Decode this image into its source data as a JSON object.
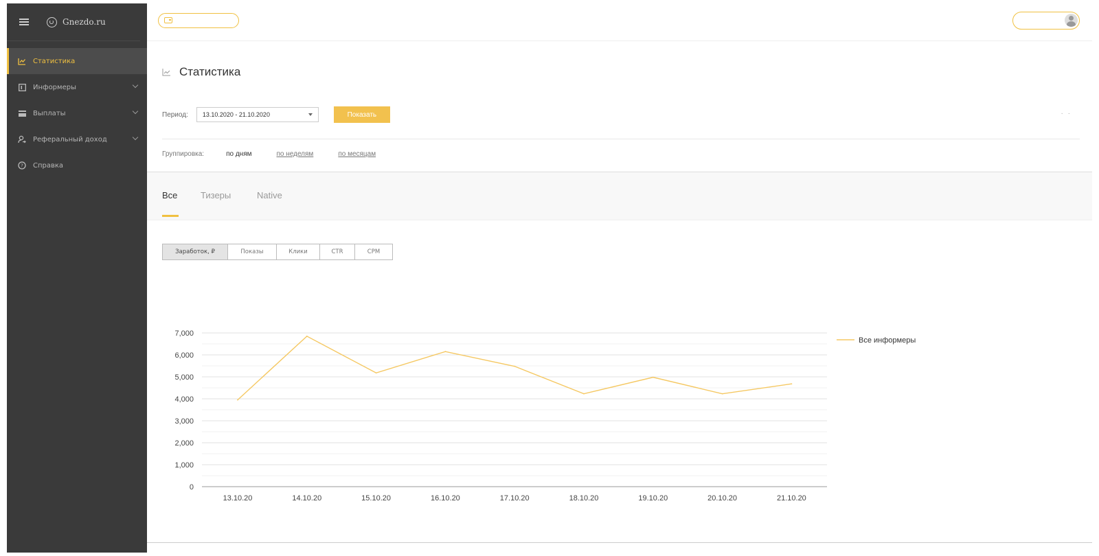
{
  "sidebar": {
    "logo_text": "Gnezdo.ru",
    "items": [
      {
        "label": "Статистика",
        "icon": "chart-icon",
        "active": true
      },
      {
        "label": "Информеры",
        "icon": "informer-icon",
        "has_children": true
      },
      {
        "label": "Выплаты",
        "icon": "card-icon",
        "has_children": true
      },
      {
        "label": "Реферальный доход",
        "icon": "referral-icon",
        "has_children": true
      },
      {
        "label": "Справка",
        "icon": "help-icon"
      }
    ]
  },
  "page": {
    "title": "Статистика",
    "period_label": "Период:",
    "period_value": "13.10.2020 - 21.10.2020",
    "show_button": "Показать",
    "dots": "· ·",
    "grouping_label": "Группировка:",
    "grouping_options": [
      "по дням",
      "по неделям",
      "по месяцам"
    ]
  },
  "tabs": [
    "Все",
    "Тизеры",
    "Native"
  ],
  "metrics": [
    "Заработок, ₽",
    "Показы",
    "Клики",
    "CTR",
    "CPM"
  ],
  "colors": {
    "accent": "#f0c040",
    "sidebar_bg": "#3a3a3a",
    "line": "#f5c862"
  },
  "chart_data": {
    "type": "line",
    "categories": [
      "13.10.20",
      "14.10.20",
      "15.10.20",
      "16.10.20",
      "17.10.20",
      "18.10.20",
      "19.10.20",
      "20.10.20",
      "21.10.20"
    ],
    "series": [
      {
        "name": "Все информеры",
        "values": [
          3950,
          6850,
          5180,
          6150,
          5480,
          4230,
          4980,
          4230,
          4680
        ]
      }
    ],
    "yticks": [
      "0",
      "1,000",
      "2,000",
      "3,000",
      "4,000",
      "5,000",
      "6,000",
      "7,000"
    ],
    "ylim": [
      0,
      7000
    ],
    "grid": true,
    "legend": "right"
  }
}
